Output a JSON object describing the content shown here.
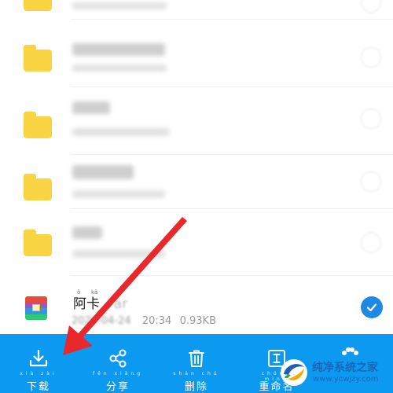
{
  "file_list": {
    "selected_file": {
      "name": "阿卡",
      "name_pinyin": [
        "ǒ",
        "kǎ"
      ],
      "name_extension": ".rar",
      "date": "2020-04-24",
      "time": "20:34",
      "size": "0.93KB",
      "selected": true
    }
  },
  "toolbar": {
    "background": "#0b9af0",
    "items": [
      {
        "label": "下载",
        "icon": "download-icon"
      },
      {
        "label": "分享",
        "icon": "share-icon"
      },
      {
        "label": "删除",
        "icon": "trash-icon"
      },
      {
        "label": "重命名",
        "icon": "rename-icon"
      }
    ]
  },
  "colors": {
    "folder": "#f9d443",
    "accent": "#1e88e5",
    "annotation_arrow": "#e8282b"
  },
  "watermark": {
    "title": "纯净系统之家",
    "url": "www.ycwjzy.com"
  }
}
